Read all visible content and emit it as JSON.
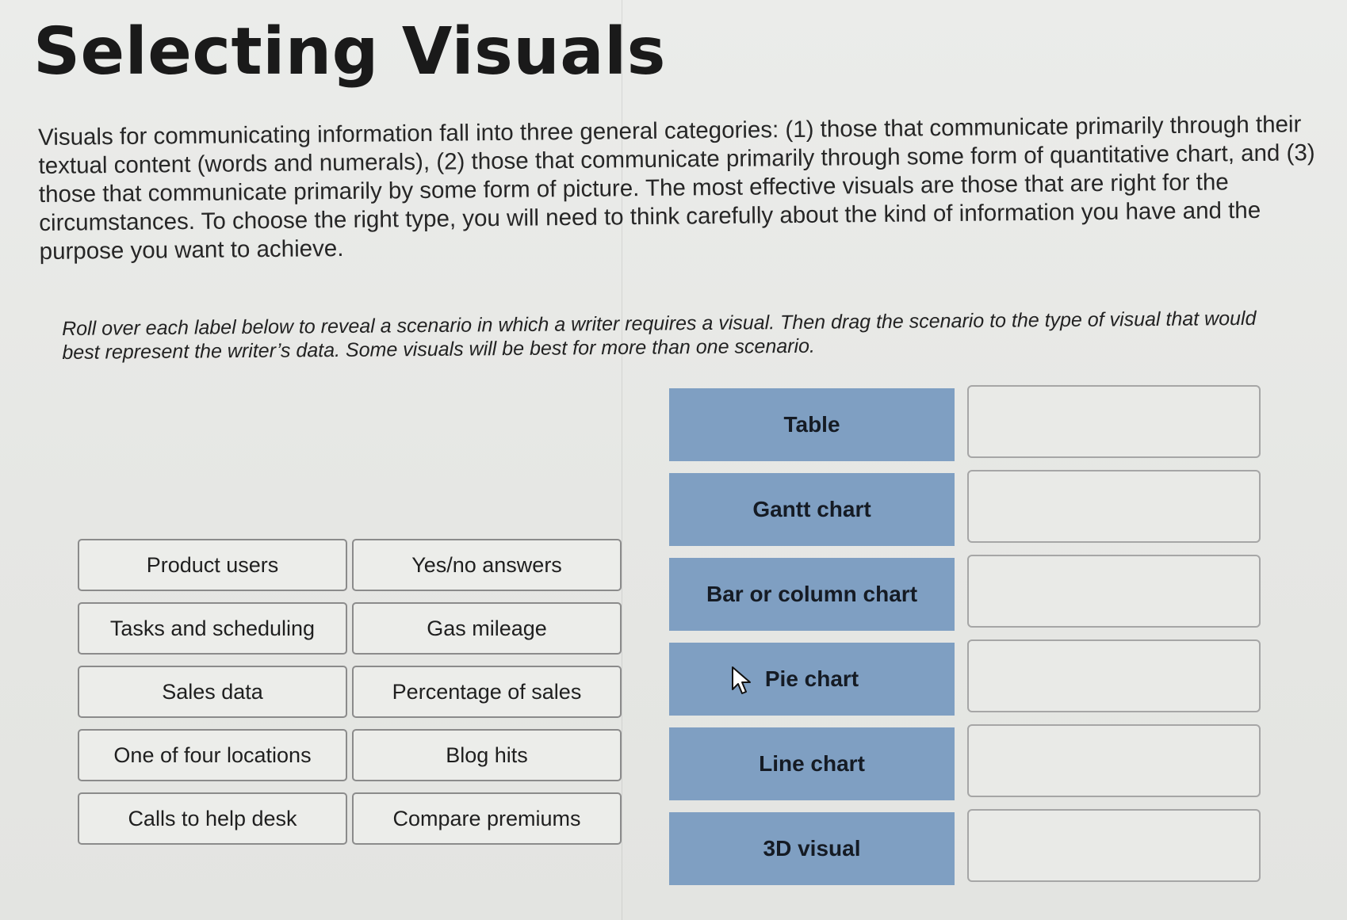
{
  "page": {
    "title": "Selecting Visuals",
    "intro": "Visuals for communicating information fall into three general categories: (1) those that communicate primarily through their textual content (words and numerals), (2) those that communicate primarily through some form of quantitative chart, and (3) those that communicate primarily by some form of picture. The most effective visuals are those that are right for the circumstances. To choose the right type, you will need to think carefully about the kind of information you have and the purpose you want to achieve.",
    "instructions": "Roll over each label below to reveal a scenario in which a writer requires a visual. Then drag the scenario to the type of visual that would best represent the writer’s data. Some visuals will be best for more than one scenario."
  },
  "scenario_labels": [
    "Product users",
    "Yes/no answers",
    "Tasks and scheduling",
    "Gas mileage",
    "Sales data",
    "Percentage of sales",
    "One of four locations",
    "Blog hits",
    "Calls to help desk",
    "Compare premiums"
  ],
  "visual_types": [
    "Table",
    "Gantt chart",
    "Bar or column chart",
    "Pie chart",
    "Line chart",
    "3D visual"
  ],
  "drop_targets": [
    "",
    "",
    "",
    "",
    "",
    ""
  ],
  "colors": {
    "category_fill": "#7f9fc2",
    "label_border": "#8b8b8b",
    "background": "#e8e9e6"
  },
  "icons": {
    "pointer": "arrow-cursor-icon"
  }
}
